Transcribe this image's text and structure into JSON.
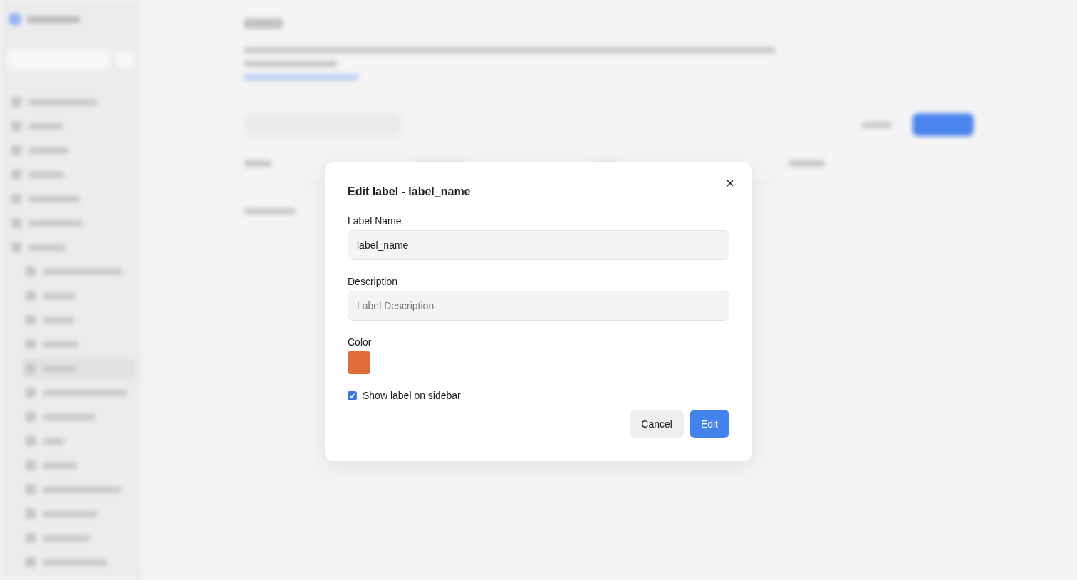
{
  "dialog": {
    "title": "Edit label - label_name",
    "fields": [
      {
        "label": "Label Name",
        "value": "label_name"
      },
      {
        "label": "Description",
        "placeholder": "Label Description"
      }
    ],
    "color_label": "Color",
    "color": "#e06c3c",
    "show_on_sidebar": {
      "label": "Show label on sidebar",
      "checked": true
    },
    "buttons": [
      {
        "label": "Cancel",
        "kind": "secondary"
      },
      {
        "label": "Edit",
        "kind": "primary"
      }
    ]
  }
}
